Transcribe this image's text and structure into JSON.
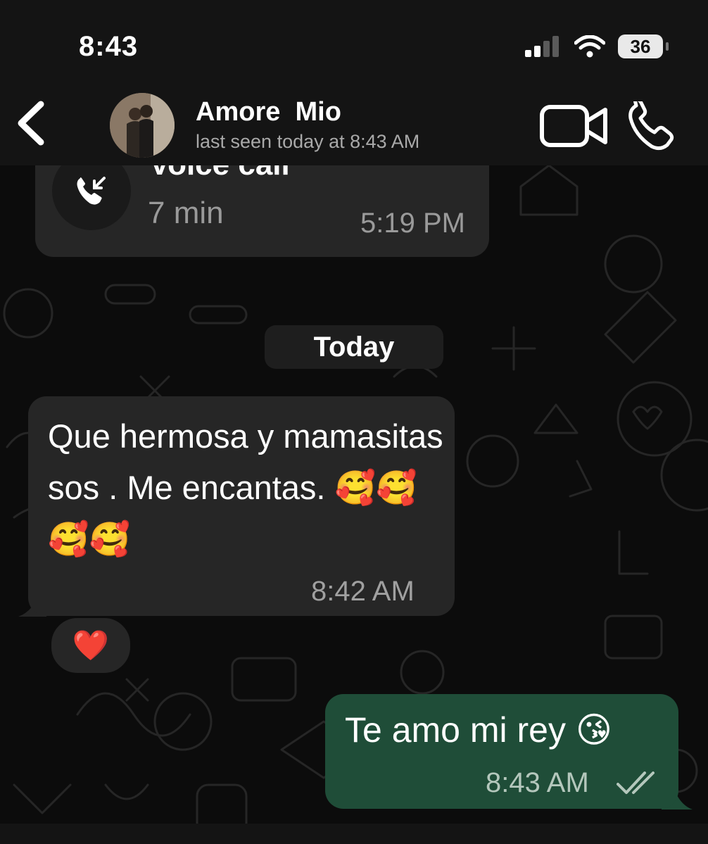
{
  "status_bar": {
    "time": "8:43",
    "battery": "36"
  },
  "header": {
    "contact_name": "Amore  Mio",
    "last_seen": "last seen today at 8:43 AM"
  },
  "call_bubble": {
    "title": "Voice call",
    "duration": "7 min",
    "time": "5:19 PM"
  },
  "date_separator": "Today",
  "messages": [
    {
      "direction": "incoming",
      "text": "Que hermosa y mamasitas sos . Me encantas. 🥰🥰🥰🥰",
      "time": "8:42 AM",
      "reaction": "❤️"
    },
    {
      "direction": "outgoing",
      "text": "Te amo mi rey 😘",
      "time": "8:43 AM",
      "status": "read"
    }
  ],
  "colors": {
    "incoming_bubble": "#262626",
    "outgoing_bubble": "#1f4d38",
    "header_bg": "#141414"
  },
  "icons": [
    "back-chevron-icon",
    "video-camera-icon",
    "phone-icon",
    "incoming-call-icon",
    "double-check-icon",
    "signal-icon",
    "wifi-icon"
  ]
}
